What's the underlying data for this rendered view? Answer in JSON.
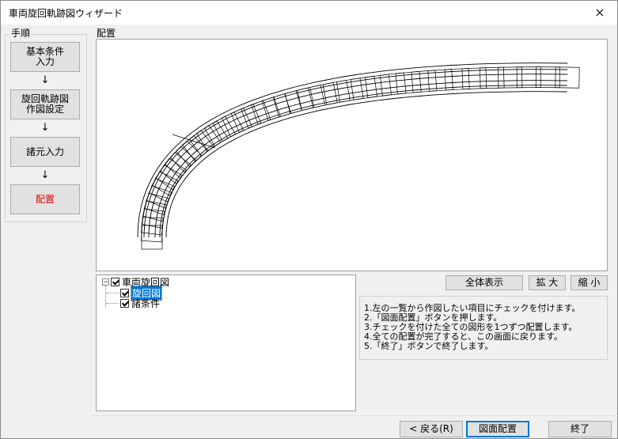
{
  "window": {
    "title": "車両旋回軌跡図ウィザード"
  },
  "steps": {
    "group_label": "手順",
    "items": [
      {
        "label": "基本条件\n入力"
      },
      {
        "label": "旋回軌跡図\n作図設定"
      },
      {
        "label": "諸元入力"
      },
      {
        "label": "配置"
      }
    ],
    "arrow": "↓"
  },
  "layout": {
    "label": "配置"
  },
  "tree": {
    "root": {
      "label": "車両旋回図",
      "expander": "−"
    },
    "children": [
      {
        "label": "旋回図",
        "selected": true
      },
      {
        "label": "諸条件",
        "selected": false
      }
    ]
  },
  "toolbar": {
    "fit_all": "全体表示",
    "zoom_in": "拡 大",
    "zoom_out": "縮 小"
  },
  "instructions": [
    "1.左の一覧から作図したい項目にチェックを付けます。",
    "2.「図面配置」ボタンを押します。",
    "3.チェックを付けた全ての図形を1つずつ配置します。",
    "4.全ての配置が完了すると、この画面に戻ります。",
    "5.「終了」ボタンで終了します。"
  ],
  "buttons": {
    "back": "< 戻る(R)",
    "place": "図面配置",
    "finish": "終了"
  },
  "colors": {
    "active_step": "#e00000",
    "selection": "#0078d7"
  },
  "icons": {
    "close": "×"
  }
}
